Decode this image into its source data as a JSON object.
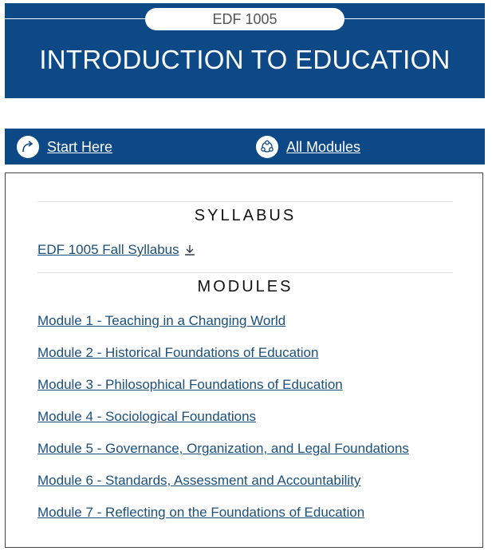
{
  "banner": {
    "course_code": "EDF 1005",
    "title": "INTRODUCTION TO EDUCATION",
    "background_color": "#0e4987"
  },
  "nav": {
    "start_here": {
      "label": "Start Here",
      "icon": "arrow-icon"
    },
    "all_modules": {
      "label": "All Modules",
      "icon": "network-icon"
    }
  },
  "syllabus": {
    "heading": "SYLLABUS",
    "link": "EDF 1005 Fall Syllabus",
    "link_icon": "download-icon"
  },
  "modules": {
    "heading": "MODULES",
    "items": [
      "Module 1 - Teaching in a Changing World",
      "Module 2 - Historical Foundations of Education",
      "Module 3 - Philosophical Foundations of Education",
      "Module 4 - Sociological Foundations",
      "Module 5 - Governance, Organization, and Legal Foundations",
      "Module 6 - Standards, Assessment and Accountability",
      "Module 7 - Reflecting on the Foundations of Education"
    ]
  }
}
